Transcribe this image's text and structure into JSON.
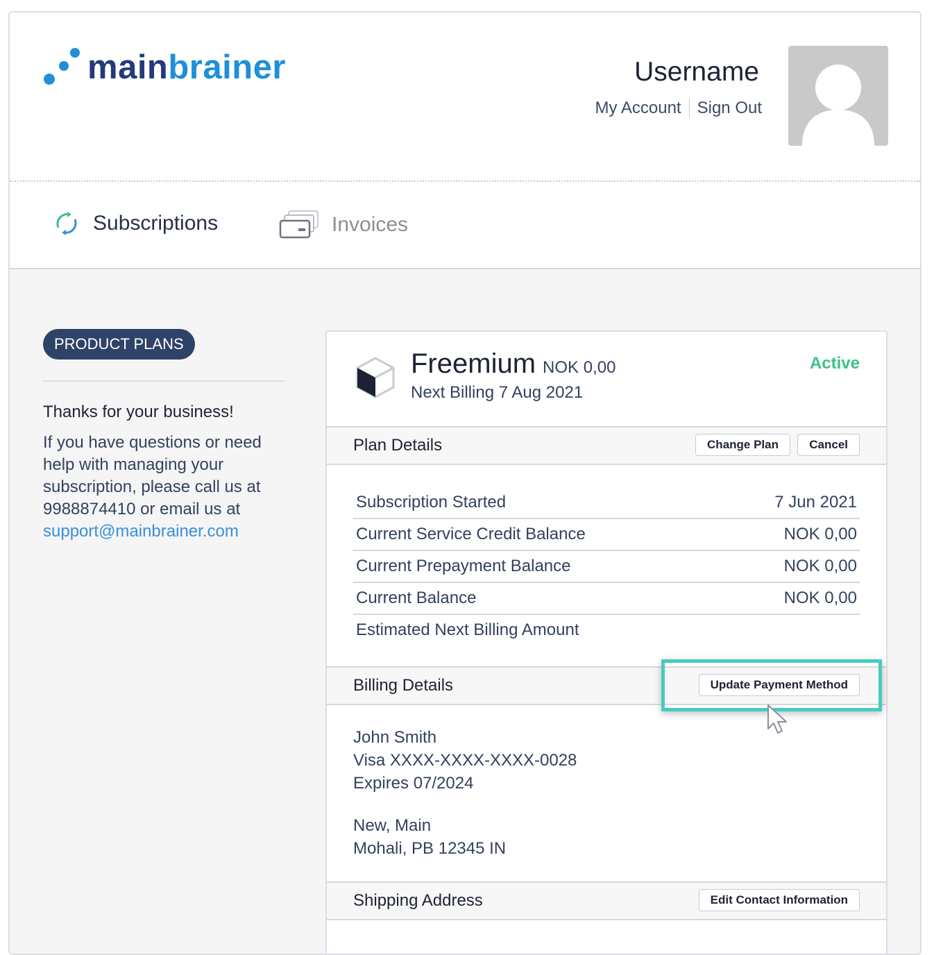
{
  "brand": {
    "logo_text_dark": "main",
    "logo_text_accent": "brainer",
    "logo_dot_color": "#1f8fd8",
    "logo_text_color": "#253a7a"
  },
  "header": {
    "username": "Username",
    "my_account": "My Account",
    "sign_out": "Sign Out",
    "avatar_icon": "default-user-avatar"
  },
  "tabs": [
    {
      "label": "Subscriptions",
      "icon": "refresh-cycle-icon",
      "active": true
    },
    {
      "label": "Invoices",
      "icon": "cards-stack-icon",
      "active": false
    }
  ],
  "sidebar": {
    "product_plans": "PRODUCT PLANS",
    "thanks": "Thanks for your business!",
    "help_text": "If you have questions or need help with managing your subscription, please call us at 9988874410 or email us at",
    "email": "support@mainbrainer.com"
  },
  "plan": {
    "name": "Freemium",
    "price": "NOK 0,00",
    "next_billing": "Next Billing 7 Aug 2021",
    "status": "Active",
    "status_color": "#3dbf88",
    "icon": "box-cube-icon"
  },
  "plan_details": {
    "title": "Plan Details",
    "change_plan": "Change Plan",
    "cancel": "Cancel",
    "rows": [
      {
        "label": "Subscription Started",
        "value": "7 Jun 2021"
      },
      {
        "label": "Current Service Credit Balance",
        "value": "NOK 0,00"
      },
      {
        "label": "Current Prepayment Balance",
        "value": "NOK 0,00"
      },
      {
        "label": "Current Balance",
        "value": "NOK 0,00"
      },
      {
        "label": "Estimated Next Billing Amount",
        "value": ""
      }
    ]
  },
  "billing_details": {
    "title": "Billing Details",
    "update_payment": "Update Payment Method",
    "name": "John Smith",
    "card": "Visa XXXX-XXXX-XXXX-0028",
    "expires": "Expires 07/2024",
    "address_line1": "New, Main",
    "address_line2": "Mohali, PB 12345 IN"
  },
  "shipping": {
    "title": "Shipping Address",
    "edit_contact": "Edit Contact Information"
  },
  "highlight_color": "#46cbbf"
}
